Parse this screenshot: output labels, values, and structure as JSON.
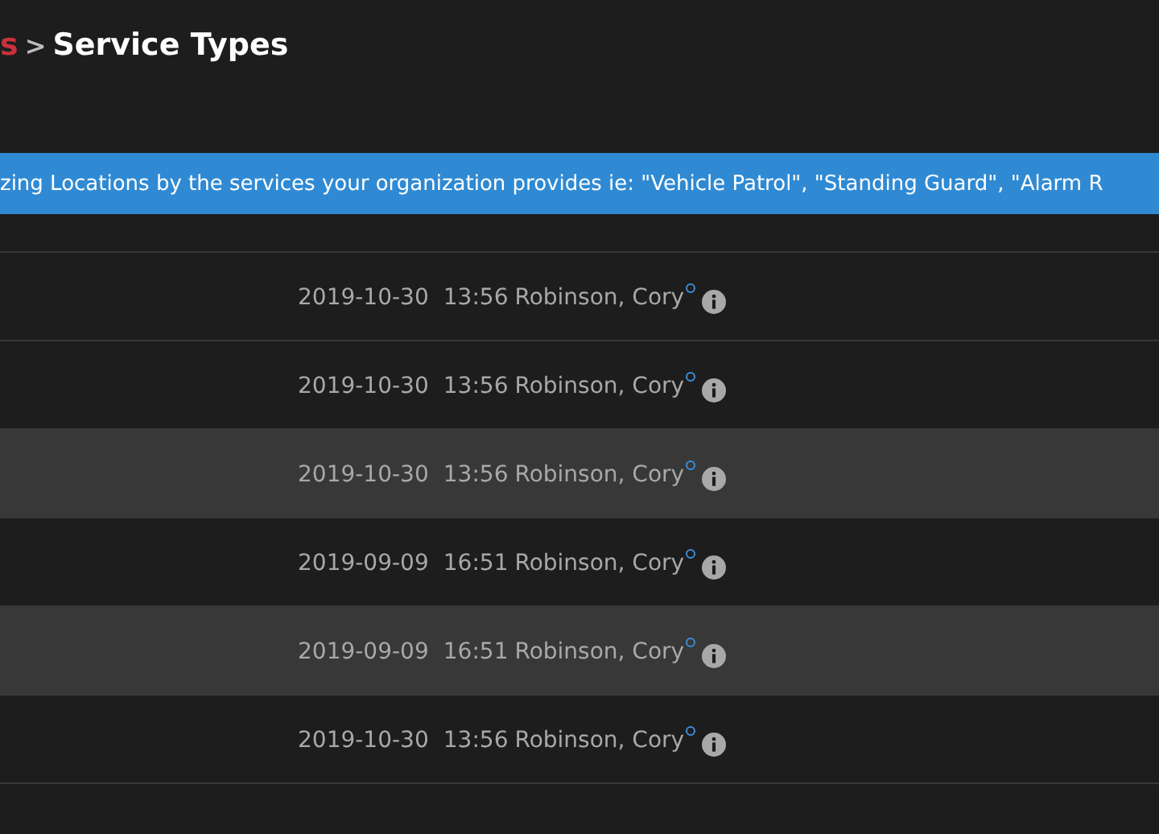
{
  "breadcrumb": {
    "parent": "s",
    "separator": ">",
    "current": "Service Types"
  },
  "banner": "zing Locations by the services your organization provides ie: \"Vehicle Patrol\", \"Standing Guard\", \"Alarm R",
  "rows": [
    {
      "date": "2019-10-30",
      "time": "13:56",
      "user": "Robinson, Cory",
      "highlighted": false
    },
    {
      "date": "2019-10-30",
      "time": "13:56",
      "user": "Robinson, Cory",
      "highlighted": false
    },
    {
      "date": "2019-10-30",
      "time": "13:56",
      "user": "Robinson, Cory",
      "highlighted": true
    },
    {
      "date": "2019-09-09",
      "time": "16:51",
      "user": "Robinson, Cory",
      "highlighted": false
    },
    {
      "date": "2019-09-09",
      "time": "16:51",
      "user": "Robinson, Cory",
      "highlighted": true
    },
    {
      "date": "2019-10-30",
      "time": "13:56",
      "user": "Robinson, Cory",
      "highlighted": false
    }
  ]
}
